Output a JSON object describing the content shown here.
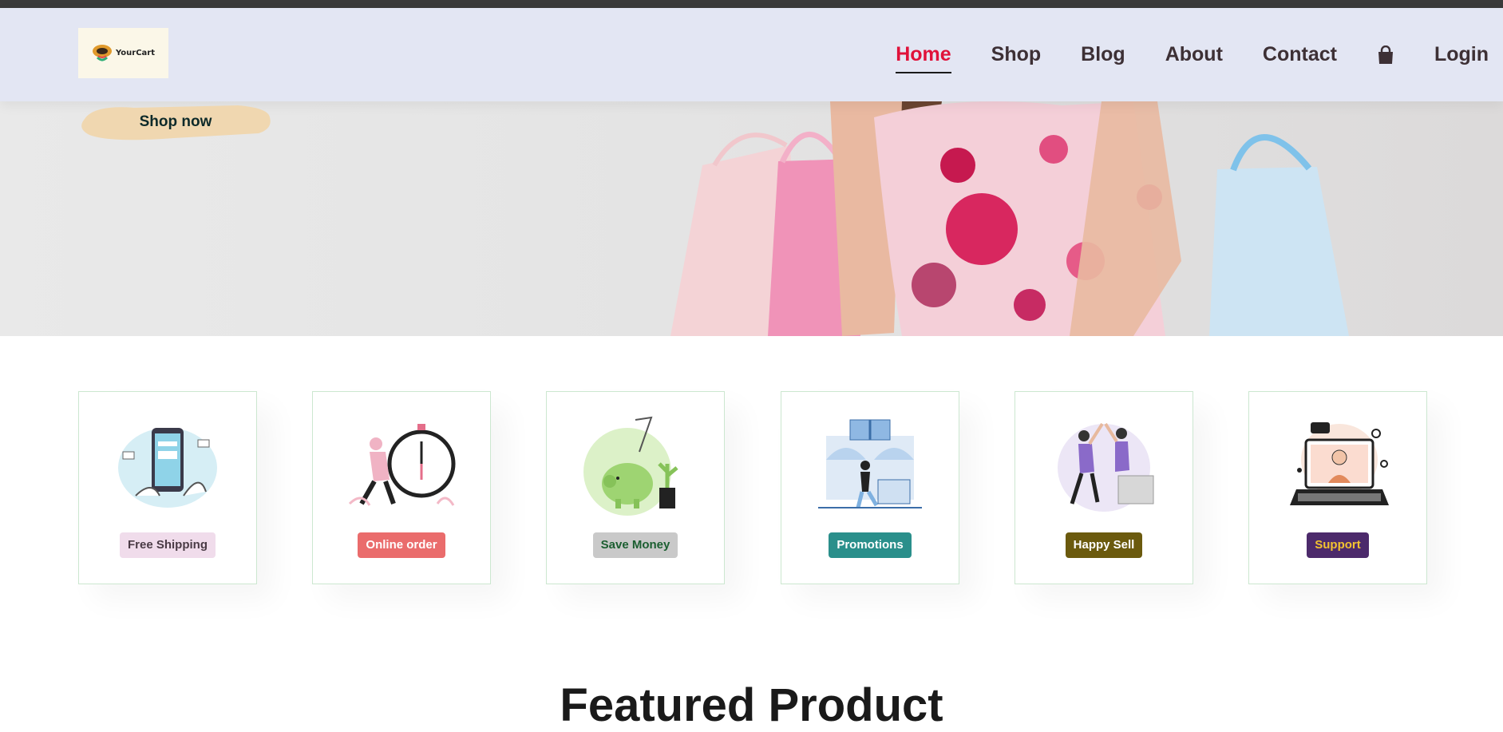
{
  "brand": {
    "logo_text": "YourCart"
  },
  "nav": {
    "items": [
      {
        "label": "Home",
        "active": true
      },
      {
        "label": "Shop"
      },
      {
        "label": "Blog"
      },
      {
        "label": "About"
      },
      {
        "label": "Contact"
      }
    ],
    "cart_icon": "shopping-bag-icon",
    "login_label": "Login"
  },
  "hero": {
    "cta_label": "Shop now"
  },
  "features": [
    {
      "label": "Free Shipping",
      "bg": "#f0dceb",
      "color": "#4a3b45"
    },
    {
      "label": "Online order",
      "bg": "#ea6c6c",
      "color": "#ffffff"
    },
    {
      "label": "Save Money",
      "bg": "#c9c9c9",
      "color": "#1b5e30"
    },
    {
      "label": "Promotions",
      "bg": "#2a8f8b",
      "color": "#ffffff"
    },
    {
      "label": "Happy Sell",
      "bg": "#6b5a0e",
      "color": "#ffffff"
    },
    {
      "label": "Support",
      "bg": "#4c2a6b",
      "color": "#f2c230"
    }
  ],
  "section": {
    "featured_title": "Featured Product"
  },
  "colors": {
    "header_bg": "#e3e6f3",
    "active_nav": "#e0123a",
    "nav_text": "#3d3035",
    "cta_brush": "#f0d7b0"
  }
}
